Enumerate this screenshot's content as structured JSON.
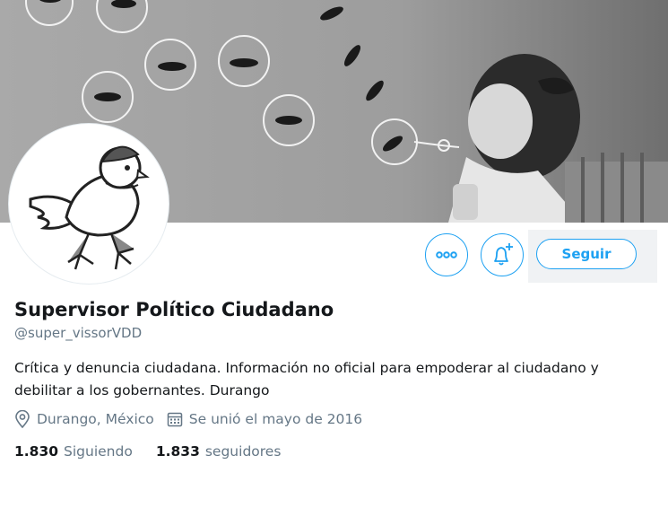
{
  "profile": {
    "name": "Supervisor Político Ciudadano",
    "handle": "@super_vissorVDD",
    "bio": "Crítica y denuncia ciudadana.  Información no oficial para empoderar al ciudadano y debilitar a los gobernantes. Durango",
    "location": "Durango, México",
    "joined": "Se unió el mayo de 2016"
  },
  "actions": {
    "more_icon": "more-options-icon",
    "bell_icon": "notification-bell-icon",
    "follow_label": "Seguir"
  },
  "stats": {
    "following_count": "1.830",
    "following_label": "Siguiendo",
    "followers_count": "1.833",
    "followers_label": "seguidores"
  },
  "icons": {
    "location": "location-pin-icon",
    "calendar": "calendar-icon"
  },
  "colors": {
    "accent": "#1da1f2",
    "muted": "#657786",
    "text": "#14171a"
  }
}
